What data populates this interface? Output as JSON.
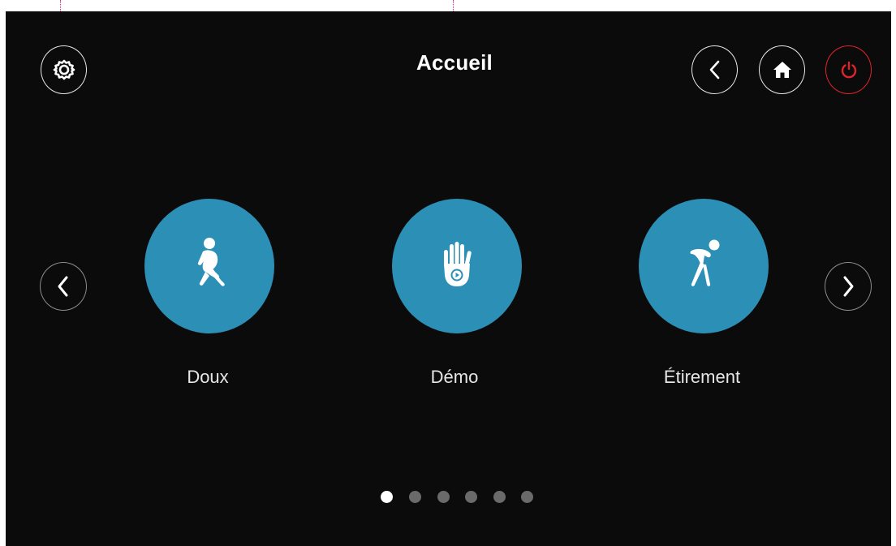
{
  "header": {
    "title": "Accueil"
  },
  "buttons": {
    "settings_icon": "gear-icon",
    "back_icon": "chevron-left-icon",
    "home_icon": "home-icon",
    "power_icon": "power-icon",
    "prev_icon": "chevron-left-icon",
    "next_icon": "chevron-right-icon"
  },
  "carousel": {
    "items": [
      {
        "label": "Doux",
        "icon": "walking-person-icon"
      },
      {
        "label": "Démo",
        "icon": "hand-play-icon"
      },
      {
        "label": "Étirement",
        "icon": "stretching-person-icon"
      }
    ],
    "page_count": 6,
    "active_page": 1
  },
  "colors": {
    "background": "#0c0b0b",
    "tile": "#2c8fb6",
    "power": "#e0242b",
    "guide": "#e0267a",
    "dot_active": "#ffffff",
    "dot_inactive": "#6a6a6a"
  }
}
